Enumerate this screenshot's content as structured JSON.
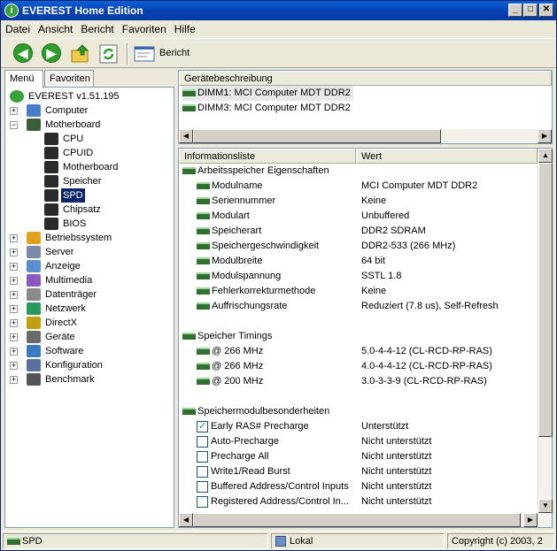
{
  "window": {
    "title": "EVEREST Home Edition"
  },
  "menu": [
    "Datei",
    "Ansicht",
    "Bericht",
    "Favoriten",
    "Hilfe"
  ],
  "toolbar": {
    "report_label": "Bericht"
  },
  "left_tabs": [
    "Menü",
    "Favoriten"
  ],
  "tree": {
    "root": "EVEREST v1.51.195",
    "items": [
      {
        "label": "Computer",
        "icon": "computer-icon",
        "expanded": false
      },
      {
        "label": "Motherboard",
        "icon": "motherboard-icon",
        "expanded": true,
        "children": [
          "CPU",
          "CPUID",
          "Motherboard",
          "Speicher",
          "SPD",
          "Chipsatz",
          "BIOS"
        ]
      },
      {
        "label": "Betriebssystem",
        "icon": "windows-icon",
        "expanded": false
      },
      {
        "label": "Server",
        "icon": "server-icon",
        "expanded": false
      },
      {
        "label": "Anzeige",
        "icon": "display-icon",
        "expanded": false
      },
      {
        "label": "Multimedia",
        "icon": "multimedia-icon",
        "expanded": false
      },
      {
        "label": "Datenträger",
        "icon": "storage-icon",
        "expanded": false
      },
      {
        "label": "Netzwerk",
        "icon": "network-icon",
        "expanded": false
      },
      {
        "label": "DirectX",
        "icon": "directx-icon",
        "expanded": false
      },
      {
        "label": "Geräte",
        "icon": "devices-icon",
        "expanded": false
      },
      {
        "label": "Software",
        "icon": "software-icon",
        "expanded": false
      },
      {
        "label": "Konfiguration",
        "icon": "config-icon",
        "expanded": false
      },
      {
        "label": "Benchmark",
        "icon": "benchmark-icon",
        "expanded": false
      }
    ],
    "selected": "SPD"
  },
  "devices": {
    "header": "Gerätebeschreibung",
    "items": [
      "DIMM1: MCI Computer MDT DDR2",
      "DIMM3: MCI Computer MDT DDR2"
    ]
  },
  "info": {
    "col1": "Informationsliste",
    "col2": "Wert",
    "sections": [
      {
        "title": "Arbeitsspeicher Eigenschaften",
        "rows": [
          {
            "k": "Modulname",
            "v": "MCI Computer MDT DDR2"
          },
          {
            "k": "Seriennummer",
            "v": "Keine"
          },
          {
            "k": "Modulart",
            "v": "Unbuffered"
          },
          {
            "k": "Speicherart",
            "v": "DDR2 SDRAM"
          },
          {
            "k": "Speichergeschwindigkeit",
            "v": "DDR2-533 (266 MHz)"
          },
          {
            "k": "Modulbreite",
            "v": "64 bit"
          },
          {
            "k": "Modulspannung",
            "v": "SSTL 1.8"
          },
          {
            "k": "Fehlerkorrekturmethode",
            "v": "Keine"
          },
          {
            "k": "Auffrischungsrate",
            "v": "Reduziert (7.8 us), Self-Refresh"
          }
        ]
      },
      {
        "title": "Speicher Timings",
        "rows": [
          {
            "k": "@ 266 MHz",
            "v": "5.0-4-4-12  (CL-RCD-RP-RAS)"
          },
          {
            "k": "@ 266 MHz",
            "v": "4.0-4-4-12  (CL-RCD-RP-RAS)"
          },
          {
            "k": "@ 200 MHz",
            "v": "3.0-3-3-9  (CL-RCD-RP-RAS)"
          }
        ]
      },
      {
        "title": "Speichermodulbesonderheiten",
        "rows": [
          {
            "k": "Early RAS# Precharge",
            "v": "Unterstützt",
            "checked": true
          },
          {
            "k": "Auto-Precharge",
            "v": "Nicht unterstützt",
            "checked": false
          },
          {
            "k": "Precharge All",
            "v": "Nicht unterstützt",
            "checked": false
          },
          {
            "k": "Write1/Read Burst",
            "v": "Nicht unterstützt",
            "checked": false
          },
          {
            "k": "Buffered Address/Control Inputs",
            "v": "Nicht unterstützt",
            "checked": false
          },
          {
            "k": "Registered Address/Control In...",
            "v": "Nicht unterstützt",
            "checked": false
          }
        ]
      }
    ]
  },
  "status": {
    "left": "SPD",
    "middle": "Lokal",
    "right": "Copyright (c) 2003, 2"
  }
}
